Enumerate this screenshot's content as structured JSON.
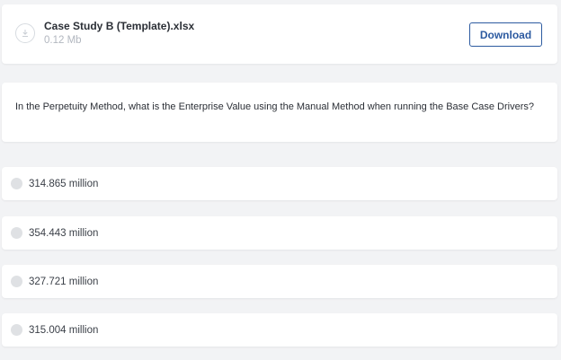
{
  "file": {
    "name": "Case Study B (Template).xlsx",
    "size": "0.12 Mb",
    "download_label": "Download"
  },
  "question": {
    "text": "In the Perpetuity Method, what is the Enterprise Value using the Manual Method when running the Base Case Drivers?"
  },
  "options": [
    {
      "label": "314.865 million"
    },
    {
      "label": "354.443 million"
    },
    {
      "label": "327.721 million"
    },
    {
      "label": "315.004 million"
    }
  ],
  "colors": {
    "accent": "#2c5aa0",
    "background": "#f2f3f5",
    "radio": "#dfe1e4"
  }
}
